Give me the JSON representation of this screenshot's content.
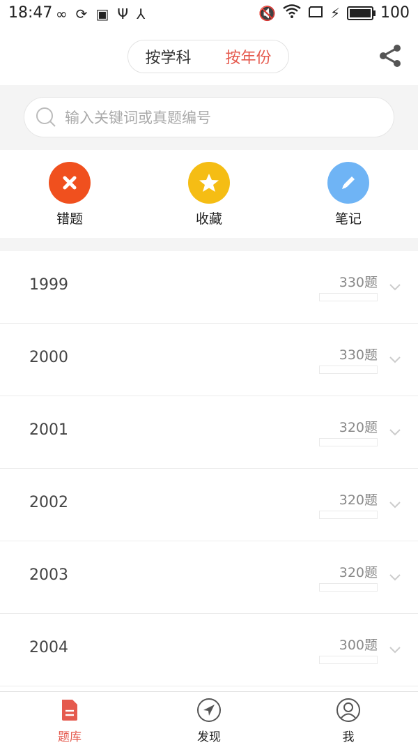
{
  "status_bar": {
    "time": "18:47",
    "battery": "100"
  },
  "header": {
    "tabs": [
      {
        "label": "按学科",
        "active": false
      },
      {
        "label": "按年份",
        "active": true
      }
    ],
    "accent_color": "#e55a4e"
  },
  "search": {
    "placeholder": "输入关键词或真题编号"
  },
  "quick_actions": [
    {
      "label": "错题",
      "icon": "close-icon",
      "color": "#f0501e"
    },
    {
      "label": "收藏",
      "icon": "star-icon",
      "color": "#f5bd14"
    },
    {
      "label": "笔记",
      "icon": "pencil-icon",
      "color": "#6fb4f5"
    }
  ],
  "years": [
    {
      "year": "1999",
      "count": "330题",
      "progress": 0
    },
    {
      "year": "2000",
      "count": "330题",
      "progress": 0
    },
    {
      "year": "2001",
      "count": "320题",
      "progress": 0
    },
    {
      "year": "2002",
      "count": "320题",
      "progress": 0
    },
    {
      "year": "2003",
      "count": "320题",
      "progress": 0
    },
    {
      "year": "2004",
      "count": "300题",
      "progress": 0
    }
  ],
  "bottom_nav": [
    {
      "label": "题库",
      "icon": "document-icon",
      "active": true
    },
    {
      "label": "发现",
      "icon": "compass-icon",
      "active": false
    },
    {
      "label": "我",
      "icon": "user-icon",
      "active": false
    }
  ]
}
